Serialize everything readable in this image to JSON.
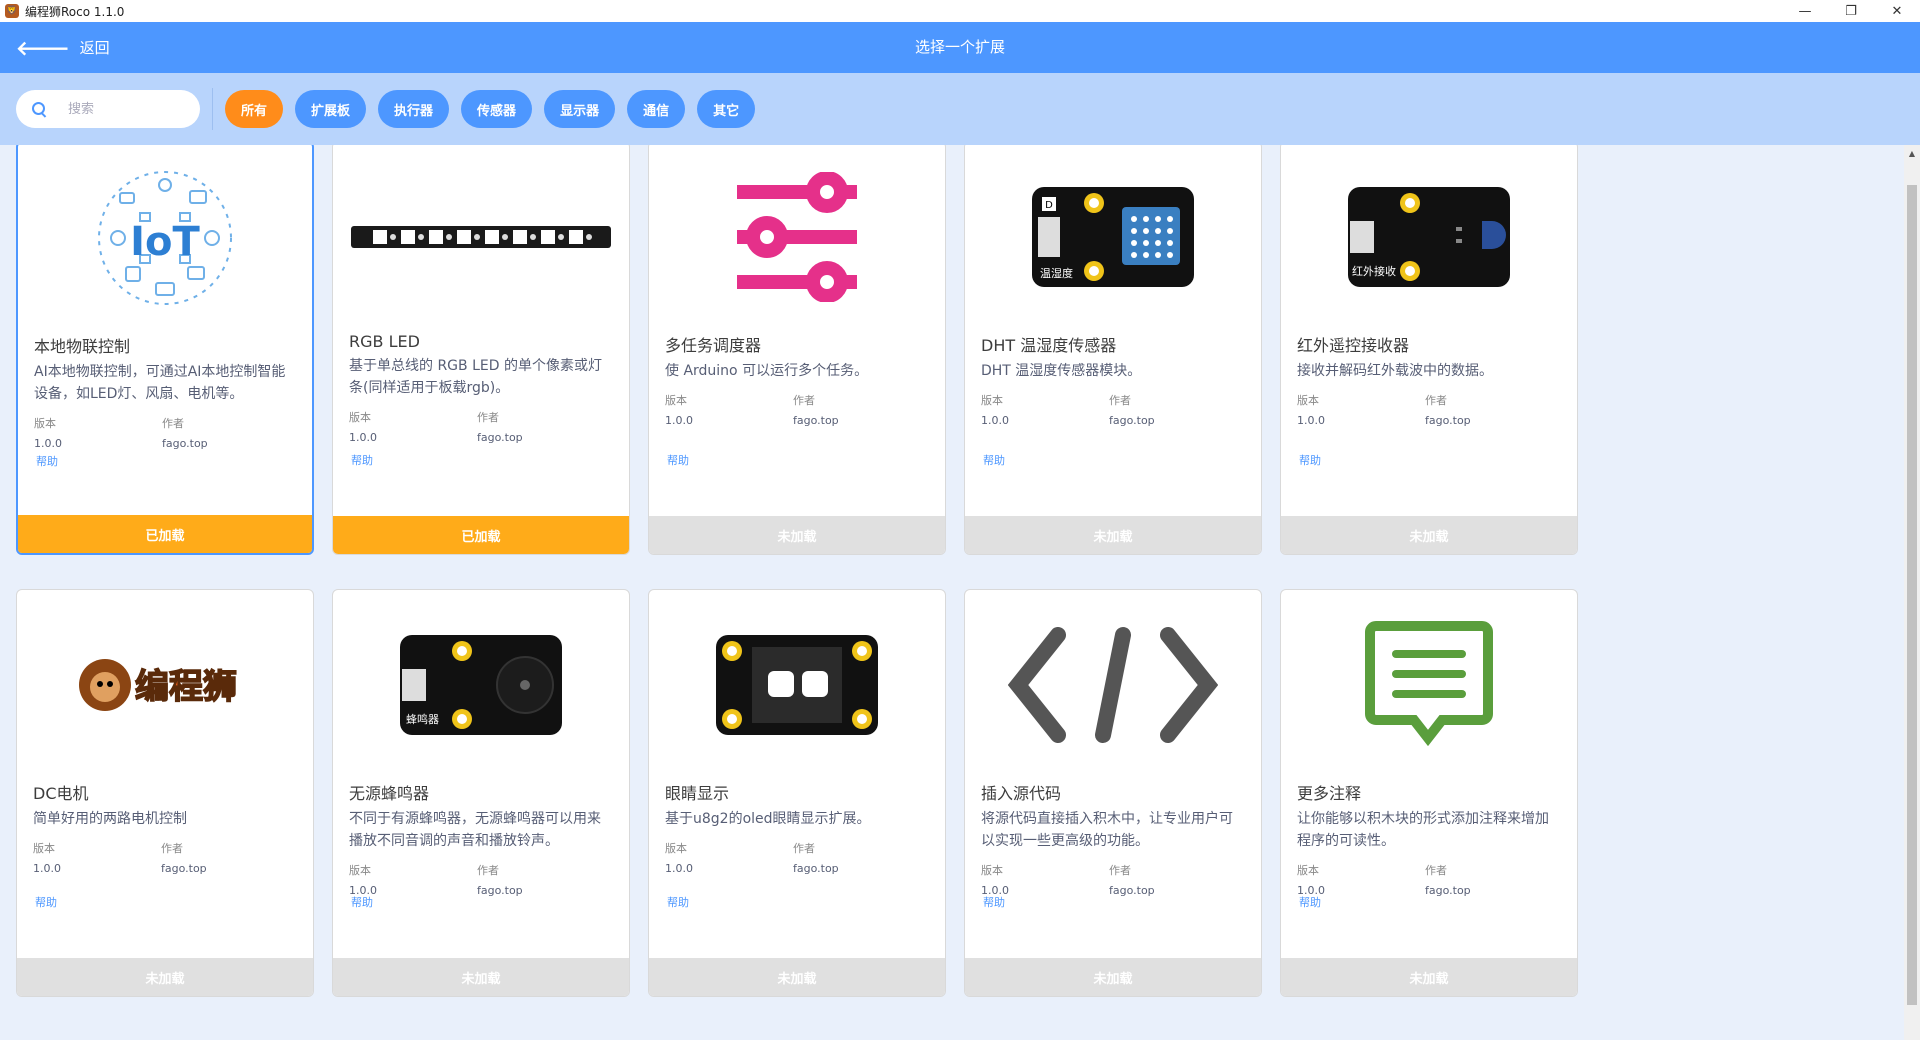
{
  "window": {
    "title": "编程狮Roco 1.1.0",
    "min": "—",
    "restore": "❐",
    "close": "✕"
  },
  "header": {
    "back_label": "返回",
    "title": "选择一个扩展"
  },
  "search": {
    "placeholder": "搜索"
  },
  "tags": [
    {
      "label": "所有",
      "active": true
    },
    {
      "label": "扩展板"
    },
    {
      "label": "执行器"
    },
    {
      "label": "传感器"
    },
    {
      "label": "显示器"
    },
    {
      "label": "通信"
    },
    {
      "label": "其它"
    }
  ],
  "meta_labels": {
    "version": "版本",
    "author": "作者"
  },
  "help_label": "帮助",
  "cards": [
    {
      "title": "本地物联控制",
      "desc": "AI本地物联控制，可通过AI本地控制智能设备，如LED灯、风扇、电机等。",
      "version": "1.0.0",
      "author": "fago.top",
      "status": "已加载",
      "image": "iot-cloud-icon"
    },
    {
      "title": "RGB LED",
      "desc": "基于单总线的 RGB LED 的单个像素或灯条(同样适用于板载rgb)。",
      "version": "1.0.0",
      "author": "fago.top",
      "status": "已加载",
      "image": "led-strip-image"
    },
    {
      "title": "多任务调度器",
      "desc": "使 Arduino 可以运行多个任务。",
      "version": "1.0.0",
      "author": "fago.top",
      "status": "未加载",
      "image": "sliders-icon"
    },
    {
      "title": "DHT 温湿度传感器",
      "desc": "DHT 温湿度传感器模块。",
      "version": "1.0.0",
      "author": "fago.top",
      "status": "未加载",
      "image": "dht-sensor-image"
    },
    {
      "title": "红外遥控接收器",
      "desc": "接收并解码红外载波中的数据。",
      "version": "1.0.0",
      "author": "fago.top",
      "status": "未加载",
      "image": "ir-receiver-image"
    },
    {
      "title": "DC电机",
      "desc": "简单好用的两路电机控制",
      "version": "1.0.0",
      "author": "fago.top",
      "status": "未加载",
      "image": "biancheng-lion-logo"
    },
    {
      "title": "无源蜂鸣器",
      "desc": "不同于有源蜂鸣器，无源蜂鸣器可以用来播放不同音调的声音和播放铃声。",
      "version": "1.0.0",
      "author": "fago.top",
      "status": "未加载",
      "image": "buzzer-module-image"
    },
    {
      "title": "眼睛显示",
      "desc": "基于u8g2的oled眼睛显示扩展。",
      "version": "1.0.0",
      "author": "fago.top",
      "status": "未加载",
      "image": "oled-eyes-image"
    },
    {
      "title": "插入源代码",
      "desc": "将源代码直接插入积木中，让专业用户可以实现一些更高级的功能。",
      "version": "1.0.0",
      "author": "fago.top",
      "status": "未加载",
      "image": "code-icon"
    },
    {
      "title": "更多注释",
      "desc": "让你能够以积木块的形式添加注释来增加程序的可读性。",
      "version": "1.0.0",
      "author": "fago.top",
      "status": "未加载",
      "image": "comment-icon"
    }
  ],
  "image_labels": {
    "dht_badge": "D",
    "dht_label": "温湿度",
    "ir_label": "红外接收",
    "buzzer_label": "蜂鸣器",
    "iot_text": "IoT",
    "logo_text": "编程狮"
  },
  "colors": {
    "primary": "#4d97ff",
    "accent": "#ff8c1a",
    "loaded": "#ffab19",
    "unloaded": "#e0e0e0",
    "filter_bg": "#b8d4fc"
  }
}
